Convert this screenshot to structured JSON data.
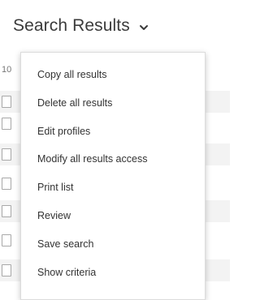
{
  "header": {
    "title": "Search Results",
    "chevron_icon": "chevron-down-icon"
  },
  "results": {
    "count_prefix": "10"
  },
  "menu": {
    "items": [
      {
        "label": "Copy all results"
      },
      {
        "label": "Delete all results"
      },
      {
        "label": "Edit profiles"
      },
      {
        "label": "Modify all results access"
      },
      {
        "label": "Print list"
      },
      {
        "label": "Review"
      },
      {
        "label": "Save search"
      },
      {
        "label": "Show criteria"
      }
    ]
  }
}
